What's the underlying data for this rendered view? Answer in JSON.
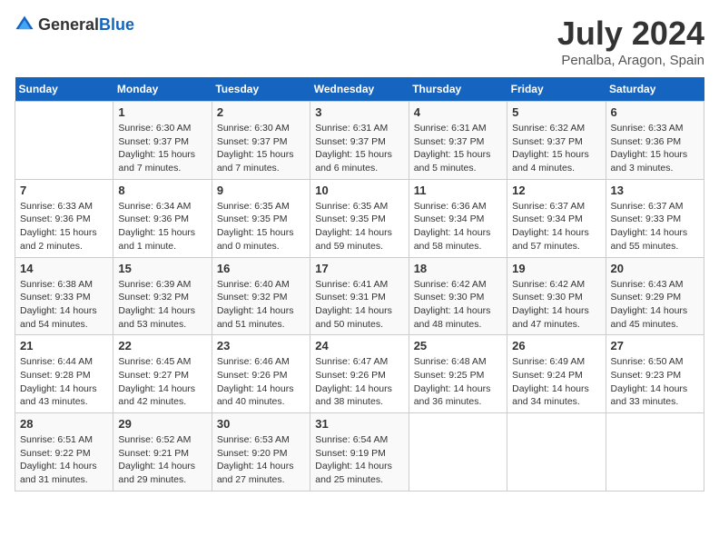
{
  "header": {
    "logo_general": "General",
    "logo_blue": "Blue",
    "title": "July 2024",
    "subtitle": "Penalba, Aragon, Spain"
  },
  "calendar": {
    "days_of_week": [
      "Sunday",
      "Monday",
      "Tuesday",
      "Wednesday",
      "Thursday",
      "Friday",
      "Saturday"
    ],
    "weeks": [
      [
        {
          "day": "",
          "info": ""
        },
        {
          "day": "1",
          "info": "Sunrise: 6:30 AM\nSunset: 9:37 PM\nDaylight: 15 hours\nand 7 minutes."
        },
        {
          "day": "2",
          "info": "Sunrise: 6:30 AM\nSunset: 9:37 PM\nDaylight: 15 hours\nand 7 minutes."
        },
        {
          "day": "3",
          "info": "Sunrise: 6:31 AM\nSunset: 9:37 PM\nDaylight: 15 hours\nand 6 minutes."
        },
        {
          "day": "4",
          "info": "Sunrise: 6:31 AM\nSunset: 9:37 PM\nDaylight: 15 hours\nand 5 minutes."
        },
        {
          "day": "5",
          "info": "Sunrise: 6:32 AM\nSunset: 9:37 PM\nDaylight: 15 hours\nand 4 minutes."
        },
        {
          "day": "6",
          "info": "Sunrise: 6:33 AM\nSunset: 9:36 PM\nDaylight: 15 hours\nand 3 minutes."
        }
      ],
      [
        {
          "day": "7",
          "info": "Sunrise: 6:33 AM\nSunset: 9:36 PM\nDaylight: 15 hours\nand 2 minutes."
        },
        {
          "day": "8",
          "info": "Sunrise: 6:34 AM\nSunset: 9:36 PM\nDaylight: 15 hours\nand 1 minute."
        },
        {
          "day": "9",
          "info": "Sunrise: 6:35 AM\nSunset: 9:35 PM\nDaylight: 15 hours\nand 0 minutes."
        },
        {
          "day": "10",
          "info": "Sunrise: 6:35 AM\nSunset: 9:35 PM\nDaylight: 14 hours\nand 59 minutes."
        },
        {
          "day": "11",
          "info": "Sunrise: 6:36 AM\nSunset: 9:34 PM\nDaylight: 14 hours\nand 58 minutes."
        },
        {
          "day": "12",
          "info": "Sunrise: 6:37 AM\nSunset: 9:34 PM\nDaylight: 14 hours\nand 57 minutes."
        },
        {
          "day": "13",
          "info": "Sunrise: 6:37 AM\nSunset: 9:33 PM\nDaylight: 14 hours\nand 55 minutes."
        }
      ],
      [
        {
          "day": "14",
          "info": "Sunrise: 6:38 AM\nSunset: 9:33 PM\nDaylight: 14 hours\nand 54 minutes."
        },
        {
          "day": "15",
          "info": "Sunrise: 6:39 AM\nSunset: 9:32 PM\nDaylight: 14 hours\nand 53 minutes."
        },
        {
          "day": "16",
          "info": "Sunrise: 6:40 AM\nSunset: 9:32 PM\nDaylight: 14 hours\nand 51 minutes."
        },
        {
          "day": "17",
          "info": "Sunrise: 6:41 AM\nSunset: 9:31 PM\nDaylight: 14 hours\nand 50 minutes."
        },
        {
          "day": "18",
          "info": "Sunrise: 6:42 AM\nSunset: 9:30 PM\nDaylight: 14 hours\nand 48 minutes."
        },
        {
          "day": "19",
          "info": "Sunrise: 6:42 AM\nSunset: 9:30 PM\nDaylight: 14 hours\nand 47 minutes."
        },
        {
          "day": "20",
          "info": "Sunrise: 6:43 AM\nSunset: 9:29 PM\nDaylight: 14 hours\nand 45 minutes."
        }
      ],
      [
        {
          "day": "21",
          "info": "Sunrise: 6:44 AM\nSunset: 9:28 PM\nDaylight: 14 hours\nand 43 minutes."
        },
        {
          "day": "22",
          "info": "Sunrise: 6:45 AM\nSunset: 9:27 PM\nDaylight: 14 hours\nand 42 minutes."
        },
        {
          "day": "23",
          "info": "Sunrise: 6:46 AM\nSunset: 9:26 PM\nDaylight: 14 hours\nand 40 minutes."
        },
        {
          "day": "24",
          "info": "Sunrise: 6:47 AM\nSunset: 9:26 PM\nDaylight: 14 hours\nand 38 minutes."
        },
        {
          "day": "25",
          "info": "Sunrise: 6:48 AM\nSunset: 9:25 PM\nDaylight: 14 hours\nand 36 minutes."
        },
        {
          "day": "26",
          "info": "Sunrise: 6:49 AM\nSunset: 9:24 PM\nDaylight: 14 hours\nand 34 minutes."
        },
        {
          "day": "27",
          "info": "Sunrise: 6:50 AM\nSunset: 9:23 PM\nDaylight: 14 hours\nand 33 minutes."
        }
      ],
      [
        {
          "day": "28",
          "info": "Sunrise: 6:51 AM\nSunset: 9:22 PM\nDaylight: 14 hours\nand 31 minutes."
        },
        {
          "day": "29",
          "info": "Sunrise: 6:52 AM\nSunset: 9:21 PM\nDaylight: 14 hours\nand 29 minutes."
        },
        {
          "day": "30",
          "info": "Sunrise: 6:53 AM\nSunset: 9:20 PM\nDaylight: 14 hours\nand 27 minutes."
        },
        {
          "day": "31",
          "info": "Sunrise: 6:54 AM\nSunset: 9:19 PM\nDaylight: 14 hours\nand 25 minutes."
        },
        {
          "day": "",
          "info": ""
        },
        {
          "day": "",
          "info": ""
        },
        {
          "day": "",
          "info": ""
        }
      ]
    ]
  }
}
